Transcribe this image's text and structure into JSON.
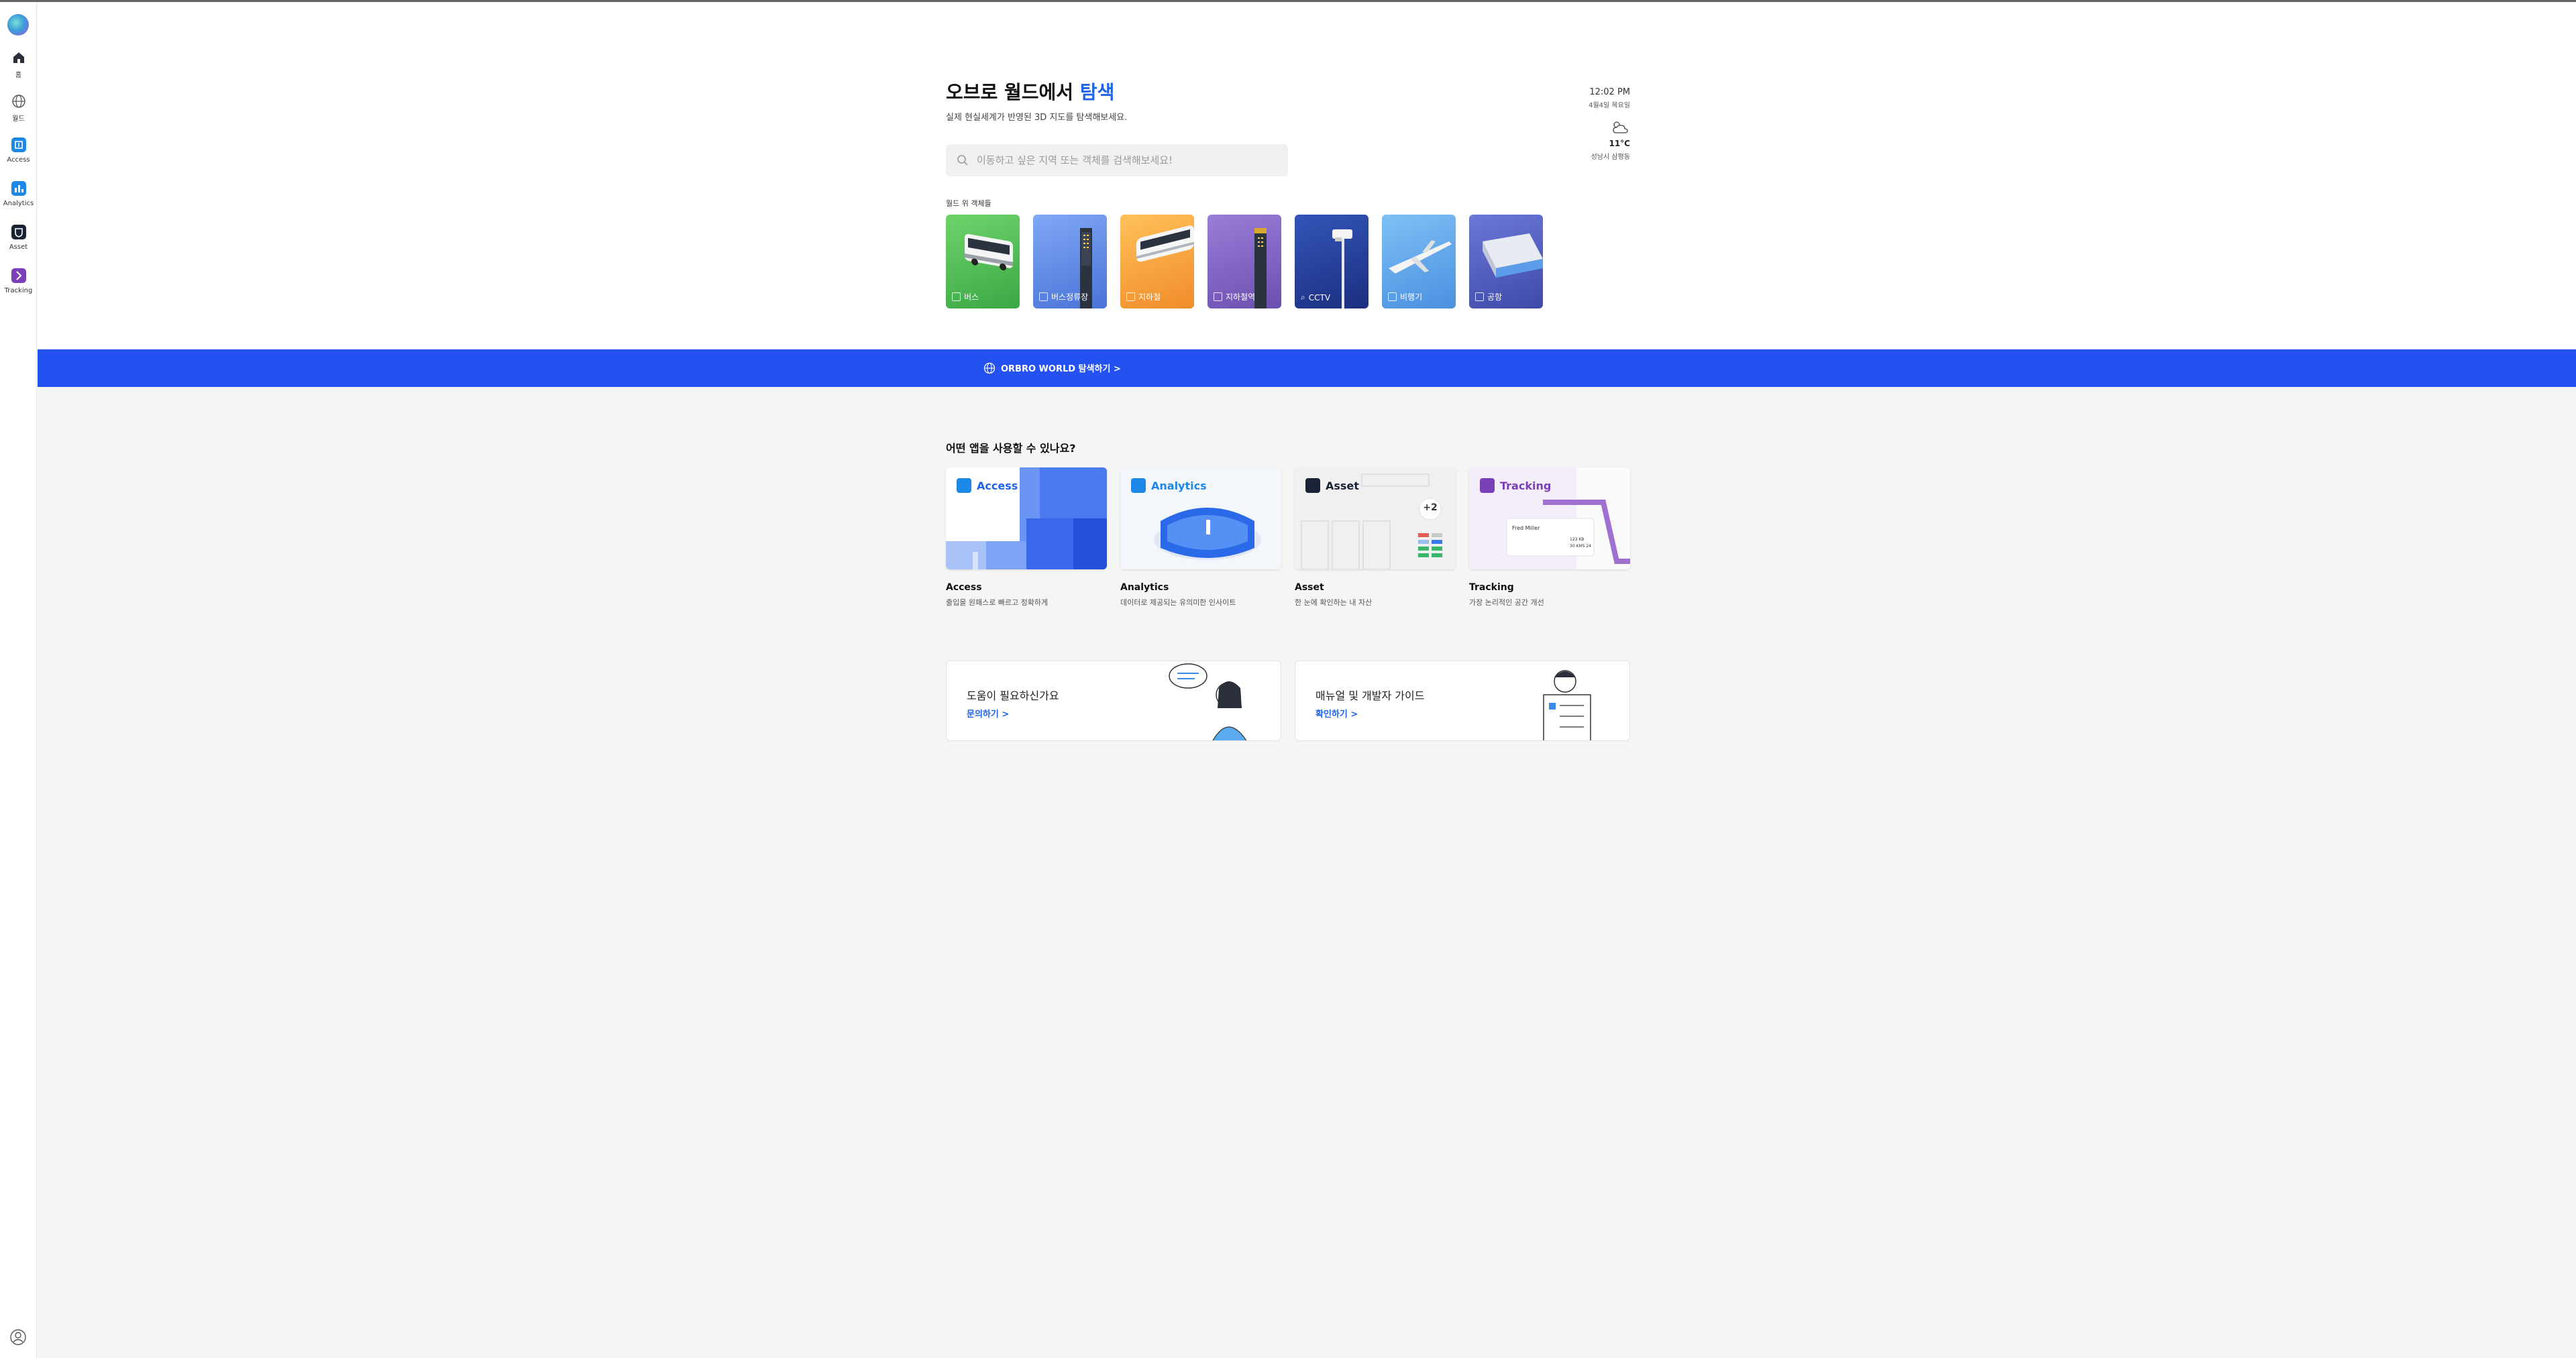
{
  "sidebar": {
    "items": [
      {
        "label": "홈",
        "icon": "home-icon"
      },
      {
        "label": "월드",
        "icon": "globe-icon"
      },
      {
        "label": "Access",
        "icon": "access-icon"
      },
      {
        "label": "Analytics",
        "icon": "analytics-icon"
      },
      {
        "label": "Asset",
        "icon": "asset-icon"
      },
      {
        "label": "Tracking",
        "icon": "tracking-icon"
      }
    ]
  },
  "hero": {
    "title_prefix": "오브로 월드에서 ",
    "title_accent": "탐색",
    "subtitle": "실제 현실세계가 반영된 3D 지도를 탐색해보세요.",
    "search_placeholder": "이동하고 싶은 지역 또는 객체를 검색해보세요!"
  },
  "status": {
    "time": "12:02 PM",
    "date": "4월4일 목요일",
    "temperature": "11°C",
    "location": "성남시 삼평동"
  },
  "objects": {
    "section_label": "월드 위 객체들",
    "items": [
      {
        "label": "버스",
        "color_top": "#6fd36b",
        "color_bottom": "#3aa845"
      },
      {
        "label": "버스정류장",
        "color_top": "#7fa8f5",
        "color_bottom": "#4a73d8"
      },
      {
        "label": "지하철",
        "color_top": "#ffc15a",
        "color_bottom": "#f08c2a"
      },
      {
        "label": "지하철역",
        "color_top": "#9b7dd8",
        "color_bottom": "#6b4fb0"
      },
      {
        "label": "CCTV",
        "color_top": "#3355b8",
        "color_bottom": "#1c2f80"
      },
      {
        "label": "비행기",
        "color_top": "#7fc0f5",
        "color_bottom": "#4a90e0"
      },
      {
        "label": "공항",
        "color_top": "#6a78d8",
        "color_bottom": "#3f4aa8"
      }
    ]
  },
  "banner": {
    "label": "ORBRO WORLD 탐색하기 >"
  },
  "apps": {
    "title": "어떤 앱을 사용할 수 있나요?",
    "items": [
      {
        "name": "Access",
        "desc": "출입을 원패스로 빠르고 정확하게",
        "accent": "#1e63e8"
      },
      {
        "name": "Analytics",
        "desc": "데이터로 제공되는 유의미한 인사이트",
        "accent": "#1e88e8"
      },
      {
        "name": "Asset",
        "desc": "한 눈에 확인하는 내 자산",
        "accent": "#1a2a4a",
        "extra": "+2"
      },
      {
        "name": "Tracking",
        "desc": "가장 논리적인 공간 개선",
        "accent": "#7b3fb8",
        "person": "Fred Miller",
        "value1": "123 KB",
        "value2": "30 KMS 24"
      }
    ]
  },
  "help": {
    "items": [
      {
        "title": "도움이 필요하신가요",
        "link": "문의하기 >"
      },
      {
        "title": "매뉴얼 및 개발자 가이드",
        "link": "확인하기 >"
      }
    ]
  }
}
